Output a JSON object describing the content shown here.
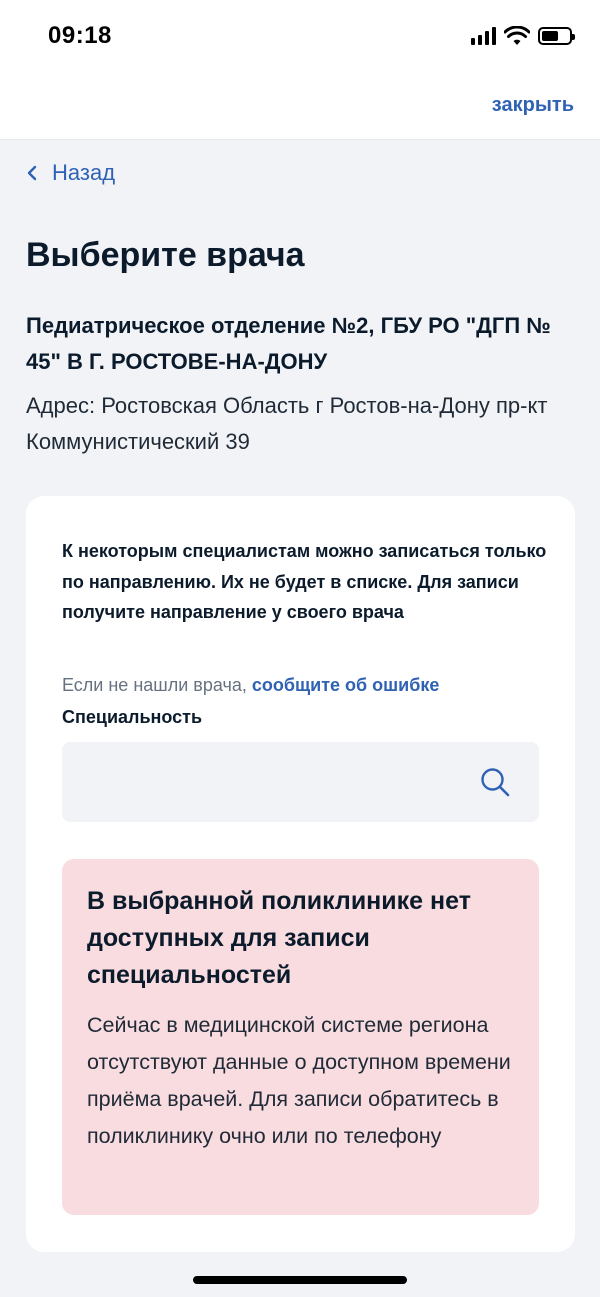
{
  "status_bar": {
    "time": "09:18",
    "icons": [
      "signal-icon",
      "wifi-icon",
      "battery-icon"
    ]
  },
  "header": {
    "close_label": "закрыть"
  },
  "nav": {
    "back_label": "Назад"
  },
  "page": {
    "title": "Выберите врача",
    "clinic_name": "Педиатрическое отделение №2, ГБУ РО \"ДГП № 45\" В Г. РОСТОВЕ-НА-ДОНУ",
    "clinic_address": "Адрес: Ростовская Область г Ростов-на-Дону пр-кт Коммунистический 39"
  },
  "card": {
    "referral_note": "К некоторым специалистам можно записаться только по направлению. Их не будет в списке. Для записи получите направление у своего врача",
    "report_prefix": "Если не нашли врача, ",
    "report_link": "сообщите об ошибке",
    "specialty_label": "Специальность",
    "specialty_value": "",
    "specialty_placeholder": ""
  },
  "alert": {
    "title": "В выбранной поликлинике нет доступных для записи специальностей",
    "text": "Сейчас в медицинской системе региона отсутствуют данные о доступном времени приёма врачей. Для записи обратитесь в поликлинику очно или по телефону"
  },
  "colors": {
    "accent": "#2f62b4",
    "background": "#f1f3f7",
    "card": "#ffffff",
    "alert_background": "#f8dce0",
    "text_primary": "#0c1b2c",
    "text_secondary": "#66727f"
  }
}
